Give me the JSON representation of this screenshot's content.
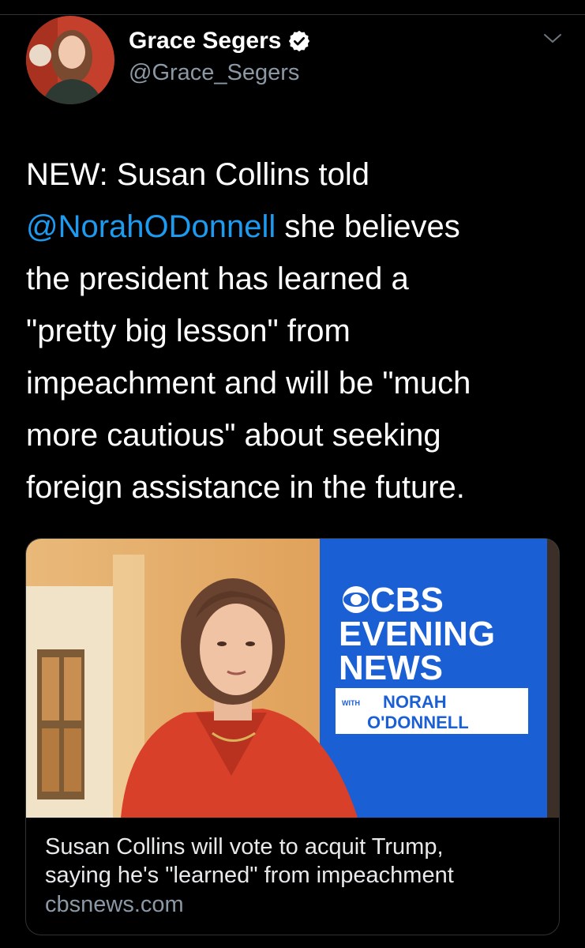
{
  "tweet": {
    "author": {
      "display_name": "Grace Segers",
      "handle": "@Grace_Segers",
      "verified": true,
      "avatar_icon": "author-avatar"
    },
    "text_lines": [
      {
        "before": "NEW: Susan Collins told",
        "mention": "",
        "after": ""
      },
      {
        "before": "",
        "mention": "@NorahODonnell",
        "after": " she believes"
      },
      {
        "before": "the president has learned a",
        "mention": "",
        "after": ""
      },
      {
        "before": "\"pretty big lesson\" from",
        "mention": "",
        "after": ""
      },
      {
        "before": "impeachment and will be \"much",
        "mention": "",
        "after": ""
      },
      {
        "before": "more cautious\" about seeking",
        "mention": "",
        "after": ""
      },
      {
        "before": "foreign assistance in the future.",
        "mention": "",
        "after": ""
      }
    ],
    "menu_icon": "chevron-down-icon"
  },
  "link_card": {
    "image_logo": {
      "brand": "CBS",
      "line2": "EVENING",
      "line3": "NEWS",
      "with": "WITH",
      "anchor_line1": "NORAH",
      "anchor_line2": "O'DONNELL"
    },
    "title_lines": [
      "Susan Collins will vote to acquit Trump,",
      "saying he's \"learned\" from impeachment"
    ],
    "domain": "cbsnews.com"
  },
  "colors": {
    "background": "#000000",
    "mention": "#1d9bf0",
    "secondary_text": "#8b98a5",
    "border": "#2f3336",
    "cbs_blue": "#1b5fd4"
  }
}
